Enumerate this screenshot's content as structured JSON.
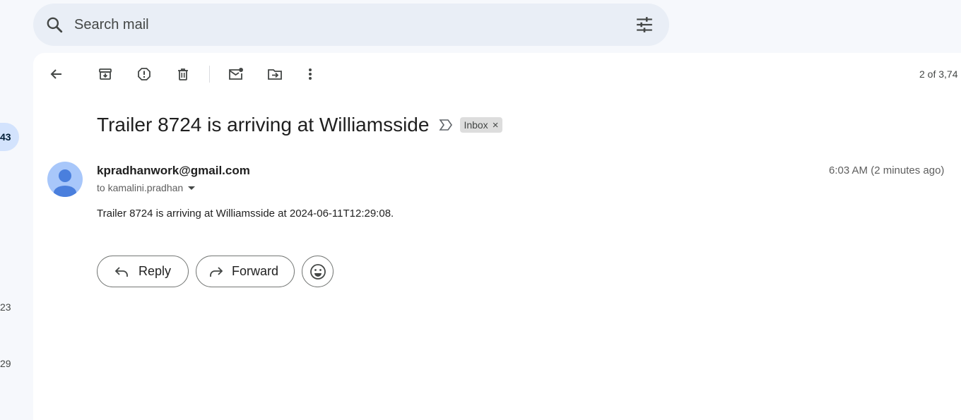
{
  "sidebar": {
    "counts": [
      "43",
      "23",
      "29"
    ]
  },
  "search": {
    "placeholder": "Search mail"
  },
  "toolbar": {
    "back": "arrow-back-icon",
    "actions": [
      "archive-icon",
      "report-spam-icon",
      "delete-icon",
      "mark-unread-icon",
      "move-to-icon",
      "more-icon"
    ],
    "pager": "2 of 3,74"
  },
  "email": {
    "subject": "Trailer 8724 is arriving at Williamsside",
    "label": "Inbox",
    "label_remove": "×",
    "sender": "kpradhanwork@gmail.com",
    "recipient": "to kamalini.pradhan",
    "timestamp": "6:03 AM (2 minutes ago)",
    "body": "Trailer 8724 is arriving at Williamsside at 2024-06-11T12:29:08."
  },
  "actions": {
    "reply": "Reply",
    "forward": "Forward"
  },
  "colors": {
    "background": "#f6f8fc",
    "search_bg": "#e9eef6",
    "active_nav": "#d3e3fd",
    "avatar_bg": "#a8c7fa",
    "avatar_fg": "#4a7fdd"
  }
}
